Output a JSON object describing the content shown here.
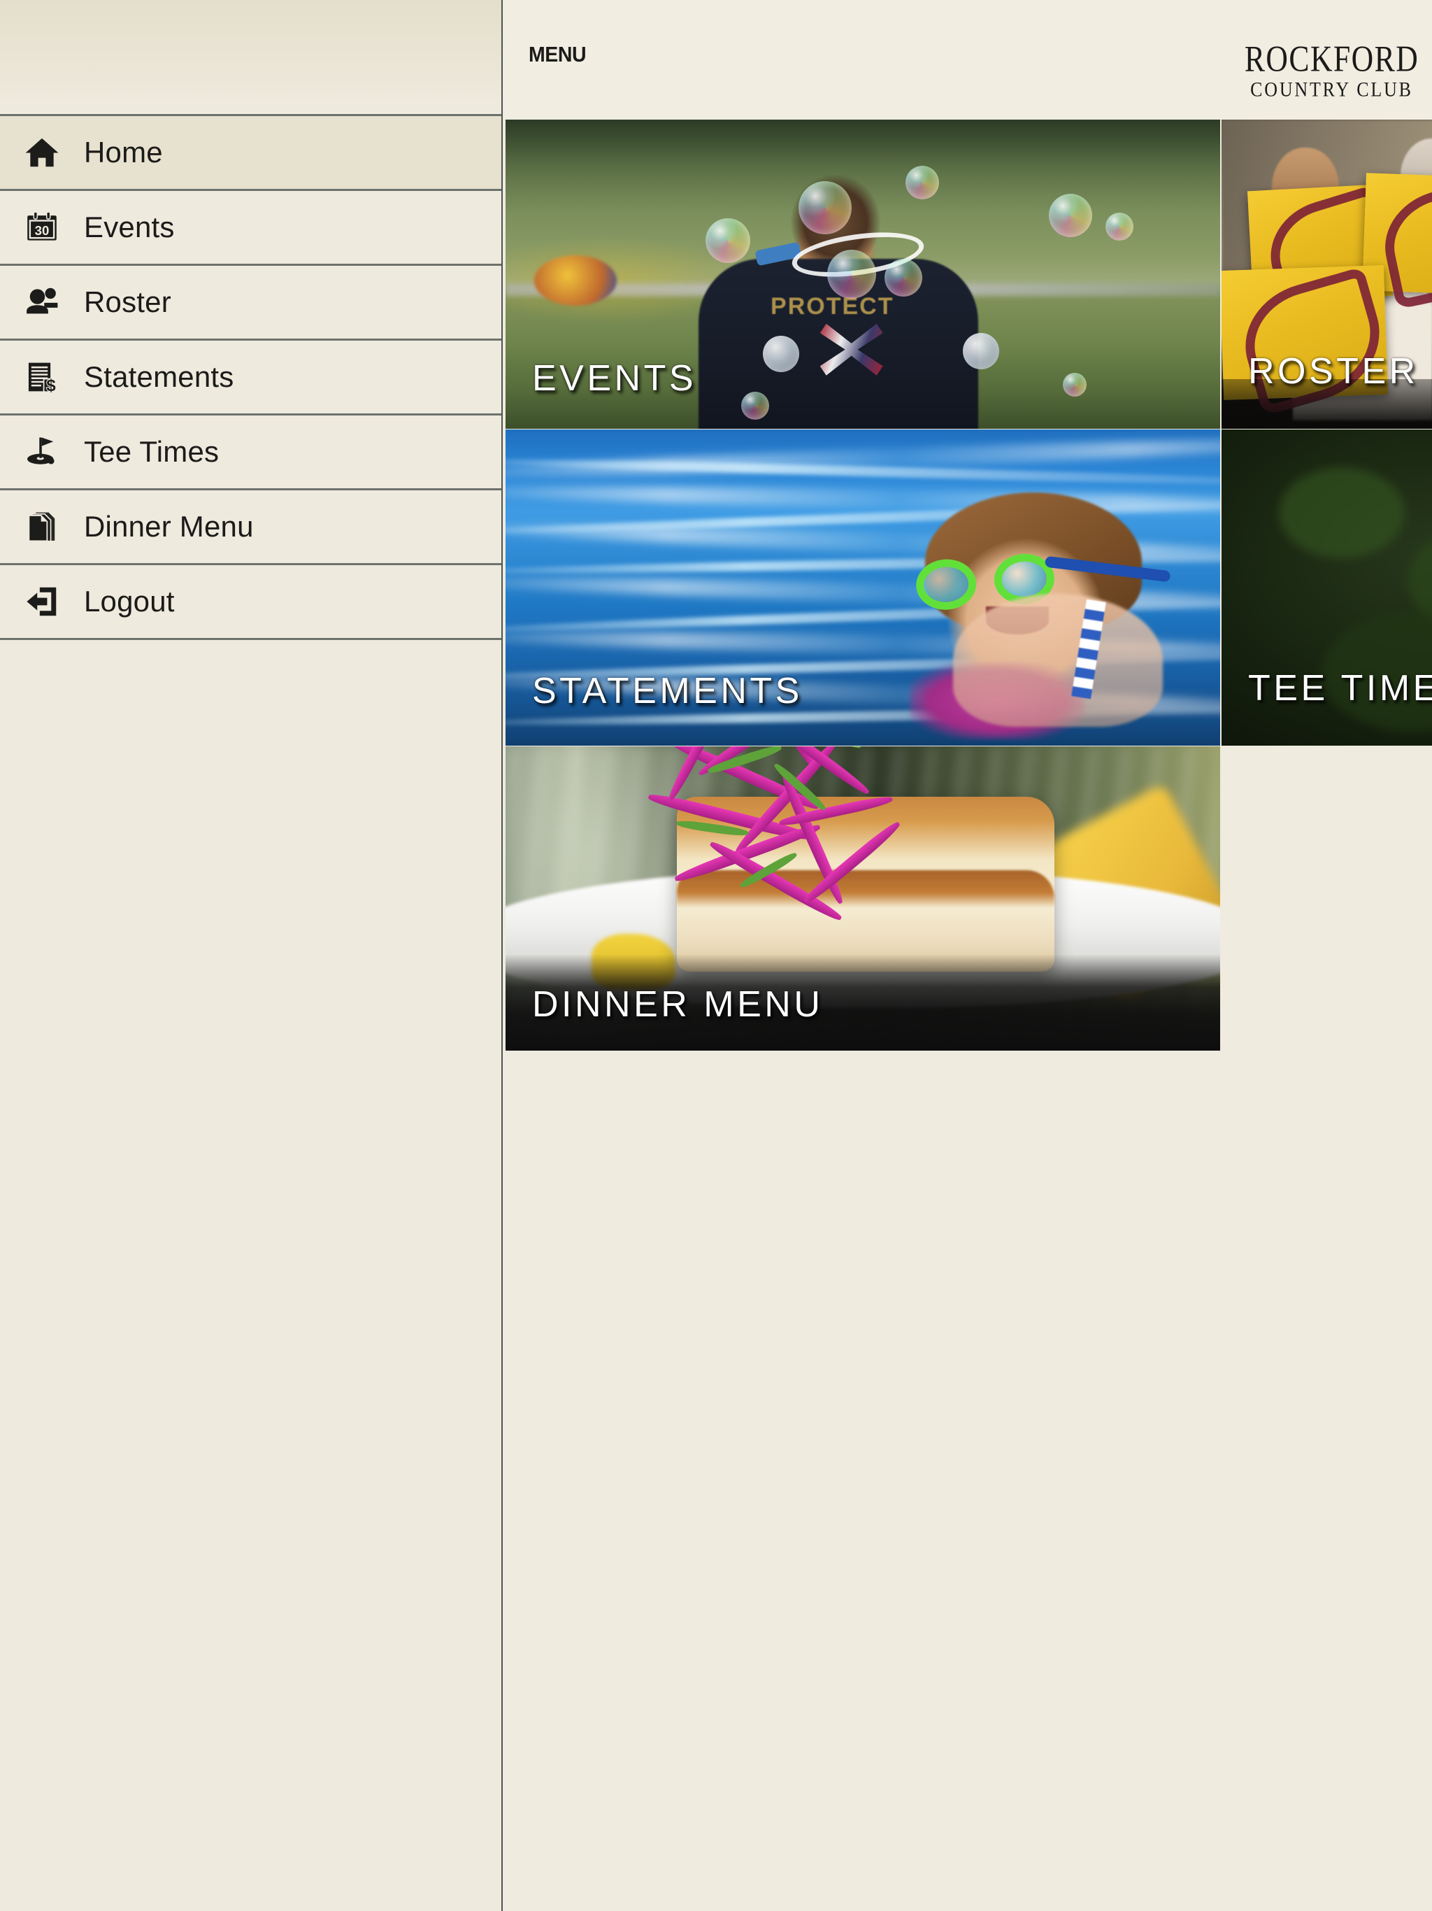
{
  "app": {
    "background_color": "#efebdf",
    "sidebar_color": "#efeade",
    "divider_color": "#6d726c"
  },
  "sidebar": {
    "items": [
      {
        "label": "Home",
        "icon": "home-icon",
        "active": true
      },
      {
        "label": "Events",
        "icon": "calendar-icon",
        "active": false
      },
      {
        "label": "Roster",
        "icon": "people-icon",
        "active": false
      },
      {
        "label": "Statements",
        "icon": "invoice-icon",
        "active": false
      },
      {
        "label": "Tee Times",
        "icon": "golf-flag-icon",
        "active": false
      },
      {
        "label": "Dinner Menu",
        "icon": "document-icon",
        "active": false
      },
      {
        "label": "Logout",
        "icon": "logout-icon",
        "active": false
      }
    ]
  },
  "topbar": {
    "menu_toggle_label": "MENU",
    "menu_toggle_icon": "hamburger-icon",
    "brand_name": "ROCKFORD",
    "brand_subtitle": "COUNTRY CLUB"
  },
  "tiles": [
    {
      "id": "events",
      "label": "EVENTS",
      "image_alt": "Boy blowing bubbles on the golf course"
    },
    {
      "id": "roster",
      "label": "ROSTER",
      "image_alt": "Members holding yellow club crest signs"
    },
    {
      "id": "statements",
      "label": "STATEMENTS",
      "image_alt": "Girl with green goggles swimming in pool"
    },
    {
      "id": "teetimes",
      "label": "TEE TIMES",
      "image_alt": "Golfer in white against dark foliage"
    },
    {
      "id": "dinner",
      "label": "DINNER MENU",
      "image_alt": "Seared fish fillet with purple cabbage slaw on white plate"
    }
  ],
  "art": {
    "events_shirt_text": "PROTECT"
  }
}
